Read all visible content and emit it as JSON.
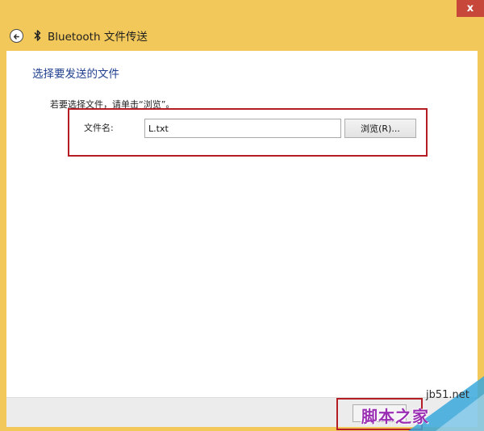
{
  "window": {
    "title": "Bluetooth 文件传送",
    "close_glyph": "x"
  },
  "icons": {
    "back": "back-arrow-icon",
    "bluetooth": "bluetooth-icon"
  },
  "content": {
    "heading": "选择要发送的文件",
    "instruction": "若要选择文件，请单击“浏览”。",
    "file_label": "文件名:",
    "file_value": "L.txt",
    "browse_label": "浏览(R)..."
  },
  "footer": {
    "next_label": ""
  },
  "watermark": {
    "url": "jb51.net",
    "name": "脚本之家"
  },
  "colors": {
    "frame": "#f2c85a",
    "close_button": "#c7473a",
    "heading": "#1f3f8f",
    "highlight": "#b51d24",
    "watermark_name": "#9a2fb3",
    "watermark_triangle": "#3aa8dd"
  }
}
